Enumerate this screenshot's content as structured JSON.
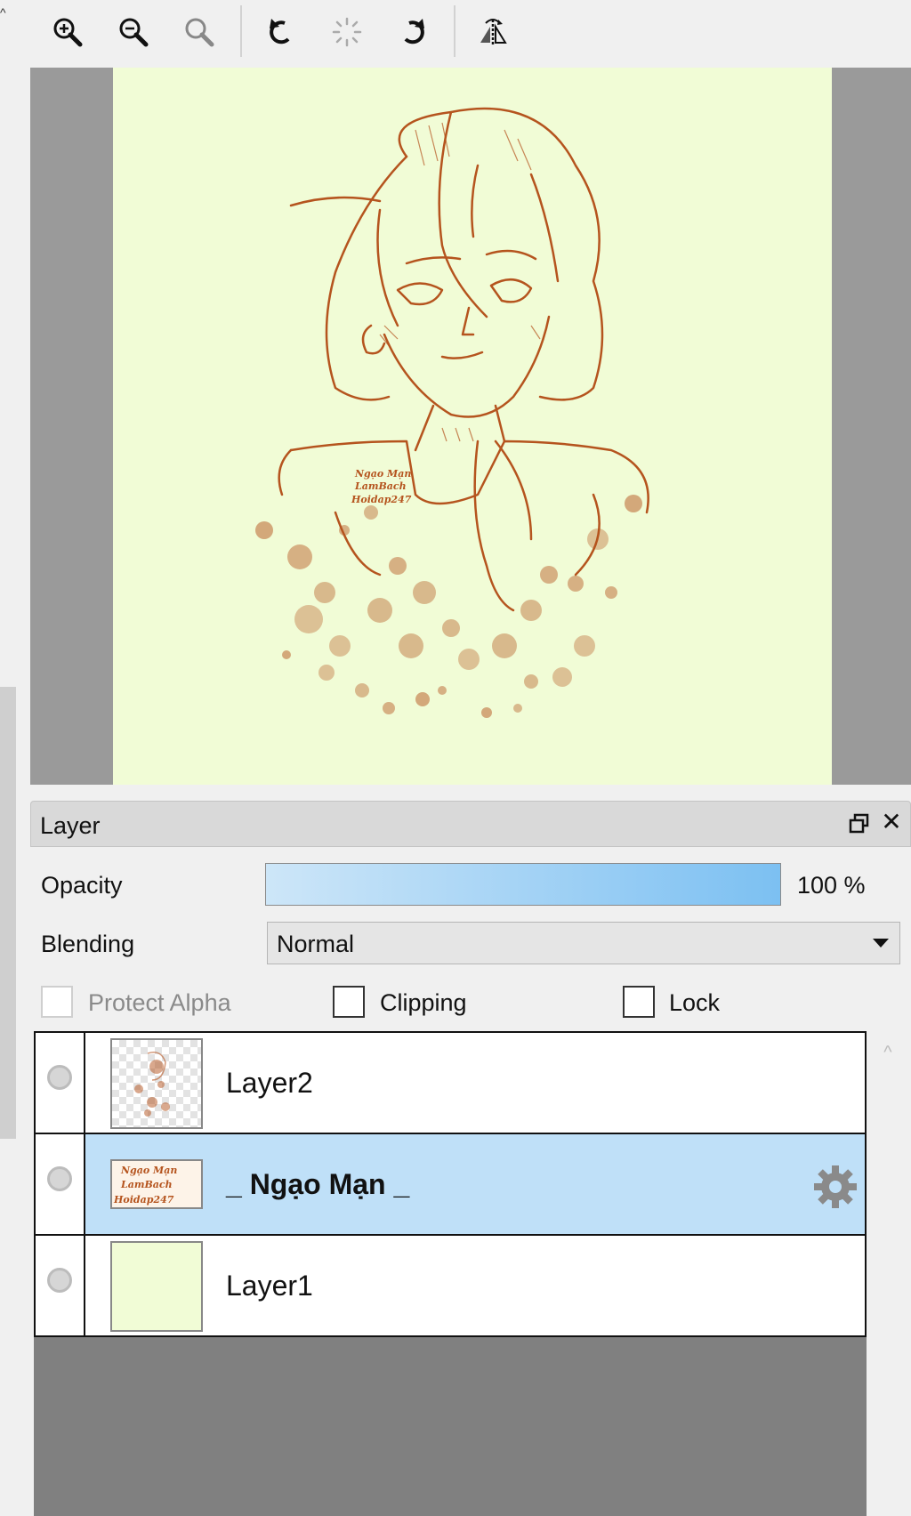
{
  "toolbar": {
    "buttons": [
      {
        "name": "zoom-in-icon"
      },
      {
        "name": "zoom-out-icon"
      },
      {
        "name": "zoom-reset-icon"
      },
      {
        "name": "rotate-left-icon"
      },
      {
        "name": "rotate-reset-icon"
      },
      {
        "name": "rotate-right-icon"
      },
      {
        "name": "flip-horizontal-icon"
      }
    ]
  },
  "canvas": {
    "background_color": "#f1fcd6",
    "line_color": "#b5541e",
    "watermark_lines": [
      "Ngạo Mạn",
      "LamBach",
      "Hoidap247"
    ]
  },
  "layer_panel": {
    "title": "Layer",
    "opacity_label": "Opacity",
    "opacity_value": "100 %",
    "opacity_fraction": 1.0,
    "blending_label": "Blending",
    "blending_value": "Normal",
    "checkboxes": {
      "protect_alpha": {
        "label": "Protect Alpha",
        "checked": false,
        "enabled": false
      },
      "clipping": {
        "label": "Clipping",
        "checked": false,
        "enabled": true
      },
      "lock": {
        "label": "Lock",
        "checked": false,
        "enabled": true
      }
    },
    "layers": [
      {
        "name": "Layer2",
        "selected": false
      },
      {
        "name": "_ Ngạo Mạn _",
        "selected": true
      },
      {
        "name": "Layer1",
        "selected": false
      }
    ],
    "selection_color": "#bfe0f8"
  }
}
